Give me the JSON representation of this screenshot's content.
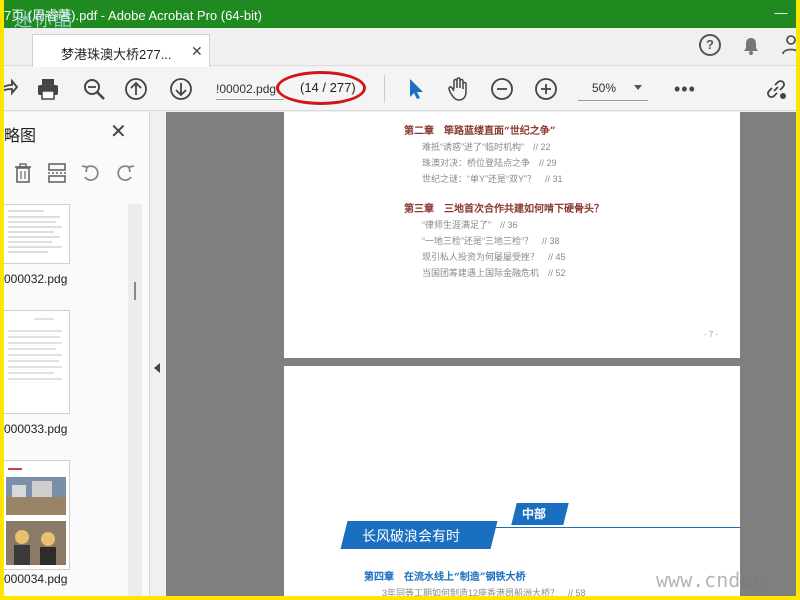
{
  "window": {
    "title": "7页 (周睿著).pdf - Adobe Acrobat Pro (64-bit)",
    "minimize_glyph": "—",
    "watermark": "迷你酷"
  },
  "tab": {
    "label": "梦港珠澳大桥277...",
    "close_glyph": "✕"
  },
  "topbar": {
    "help_glyph": "?"
  },
  "toolbar": {
    "page_input_value": "!00002.pdg",
    "page_count": "(14 / 277)",
    "zoom": "50%",
    "more_glyph": "•••",
    "highlight_color": "#d0161b"
  },
  "leftpane": {
    "title": "略图",
    "close_glyph": "✕",
    "thumbnails": [
      {
        "label": "000032.pdg"
      },
      {
        "label": "000033.pdg"
      },
      {
        "label": "000034.pdg"
      }
    ]
  },
  "document": {
    "page1": {
      "chapters": [
        {
          "title": "第二章　筚路蓝缕直面“世纪之争”",
          "entries": [
            "难抵“诱惑”进了“临时机构”　// 22",
            "珠澳对决：桥位登陆点之争　// 29",
            "世纪之谜：“单Y”还是“双Y”？　// 31"
          ]
        },
        {
          "title": "第三章　三地首次合作共建如何啃下硬骨头？",
          "entries": [
            "“律师生涯满足了”　// 36",
            "“一地三检”还是“三地三检”？　// 38",
            "现引私人投资为何屡屡受挫？　// 45",
            "当国团筹建遇上国际金融危机　// 52"
          ]
        }
      ],
      "page_number": "- 7 -"
    },
    "page2": {
      "banner_tag": "中部",
      "banner_text": "长风破浪会有时",
      "chapter4": "第四章　在流水线上“制造”钢铁大桥",
      "chapter4_entry": "3年同等工期如何制造12座香港昂船洲大桥？　// 58"
    }
  },
  "footer": {
    "watermark": "www.cndac"
  },
  "colors": {
    "titlebar_bg": "#1f8a1f",
    "accent_blue": "#1b6fc1",
    "chapter_red": "#8a3a2e",
    "doc_bg": "#7f7f7f"
  },
  "icons": {
    "toolbar": [
      "share-icon",
      "print-icon",
      "zoom-search-icon",
      "prev-page-icon",
      "next-page-icon",
      "select-cursor-icon",
      "hand-icon",
      "zoom-out-icon",
      "zoom-in-icon",
      "link-icon"
    ],
    "leftpane": [
      "delete-icon",
      "extract-pages-icon",
      "undo-icon",
      "redo-icon"
    ],
    "topbar": [
      "help-icon",
      "bell-icon",
      "account-icon"
    ]
  }
}
